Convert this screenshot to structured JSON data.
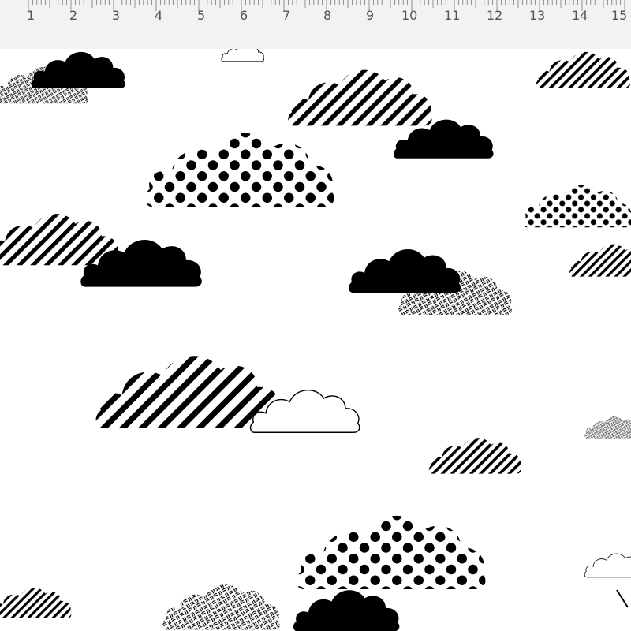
{
  "ruler": {
    "numbers": [
      "1",
      "2",
      "3",
      "4",
      "5",
      "6",
      "7",
      "8",
      "9",
      "10",
      "11",
      "12",
      "13",
      "14",
      "15"
    ]
  },
  "pattern": {
    "cloud_styles": [
      "solid-black",
      "diagonal-stripes",
      "polka-dots",
      "woven-hatch",
      "outline"
    ],
    "colors": {
      "ink": "#000000",
      "fabric": "#ffffff",
      "ruler_bg": "#f2f2f2",
      "ruler_text": "#555555"
    }
  }
}
